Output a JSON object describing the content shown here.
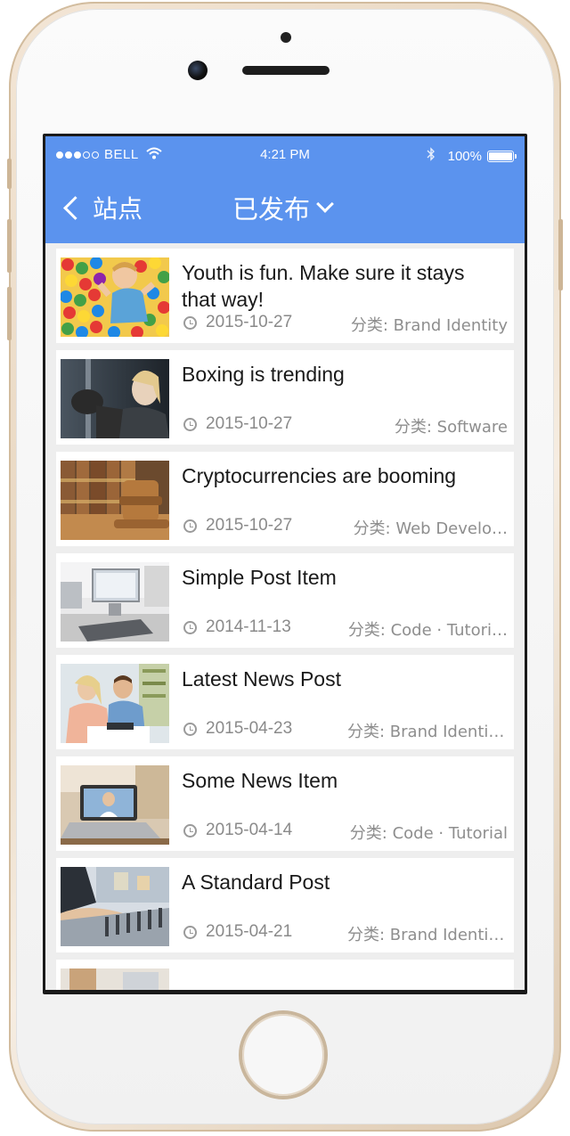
{
  "status_bar": {
    "carrier": "BELL",
    "time": "4:21 PM",
    "battery": "100%",
    "battery_level": 1.0,
    "signal_bars_filled": 3,
    "signal_bars_total": 5
  },
  "nav": {
    "back_label": "站点",
    "title": "已发布",
    "accent_color": "#5b93ee"
  },
  "posts": [
    {
      "title": "Youth is fun. Make sure it stays that way!",
      "date": "2015-10-27",
      "category": "分类: Brand Identity",
      "thumb_icon": "kid-in-ball-pit-image"
    },
    {
      "title": "Boxing is trending",
      "date": "2015-10-27",
      "category": "分类: Software",
      "thumb_icon": "boxer-image"
    },
    {
      "title": "Cryptocurrencies are booming",
      "date": "2015-10-27",
      "category": "分类: Web Develo…",
      "thumb_icon": "gavel-image"
    },
    {
      "title": "Simple Post Item",
      "date": "2014-11-13",
      "category": "分类: Code · Tutori…",
      "thumb_icon": "computer-desk-image"
    },
    {
      "title": "Latest News Post",
      "date": "2015-04-23",
      "category": "分类: Brand Identit…",
      "thumb_icon": "office-people-image"
    },
    {
      "title": "Some News Item",
      "date": "2015-04-14",
      "category": "分类: Code · Tutorial",
      "thumb_icon": "laptop-image"
    },
    {
      "title": "A Standard Post",
      "date": "2015-04-21",
      "category": "分类: Brand Identit…",
      "thumb_icon": "mixing-desk-image"
    },
    {
      "title": "",
      "date": "",
      "category": "",
      "thumb_icon": "partial-post-image"
    }
  ]
}
